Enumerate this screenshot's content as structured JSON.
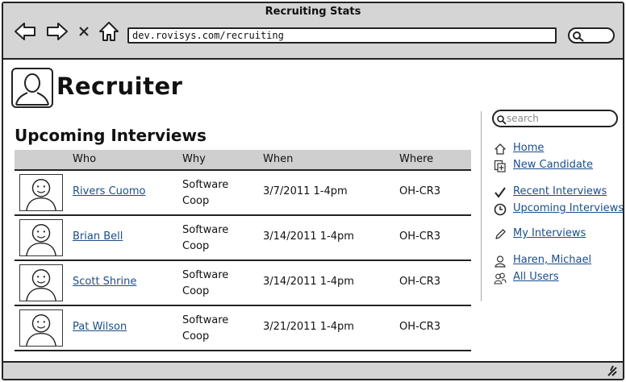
{
  "window": {
    "title": "Recruiting Stats"
  },
  "browser": {
    "url": "dev.rovisys.com/recruiting",
    "icons": [
      "back-arrow-icon",
      "forward-arrow-icon",
      "close-x-icon",
      "home-icon",
      "search-icon"
    ]
  },
  "app": {
    "title": "Recruiter",
    "logo_icon": "user-silhouette-icon"
  },
  "section": {
    "title": "Upcoming Interviews"
  },
  "table": {
    "columns": [
      "Who",
      "Why",
      "When",
      "Where"
    ],
    "rows": [
      {
        "name": "Rivers Cuomo",
        "why_line1": "Software",
        "why_line2": "Coop",
        "when": "3/7/2011 1-4pm",
        "where": "OH-CR3"
      },
      {
        "name": "Brian Bell",
        "why_line1": "Software",
        "why_line2": "Coop",
        "when": "3/14/2011 1-4pm",
        "where": "OH-CR3"
      },
      {
        "name": "Scott Shrine",
        "why_line1": "Software",
        "why_line2": "Coop",
        "when": "3/14/2011 1-4pm",
        "where": "OH-CR3"
      },
      {
        "name": "Pat Wilson",
        "why_line1": "Software",
        "why_line2": "Coop",
        "when": "3/21/2011 1-4pm",
        "where": "OH-CR3"
      }
    ]
  },
  "sidebar": {
    "search_placeholder": "search",
    "items": [
      {
        "label": "Home",
        "icon": "home-icon"
      },
      {
        "label": "New Candidate",
        "icon": "add-document-icon"
      },
      {
        "label": "Recent Interviews",
        "icon": "checkmark-icon"
      },
      {
        "label": "Upcoming Interviews",
        "icon": "clock-icon"
      },
      {
        "label": "My Interviews",
        "icon": "pencil-icon"
      },
      {
        "label": "Haren, Michael",
        "icon": "user-icon"
      },
      {
        "label": "All Users",
        "icon": "users-icon"
      }
    ]
  },
  "colors": {
    "chrome": "#d5d5d5",
    "link": "#1a4e8a",
    "table_header": "#cfcfcf"
  }
}
